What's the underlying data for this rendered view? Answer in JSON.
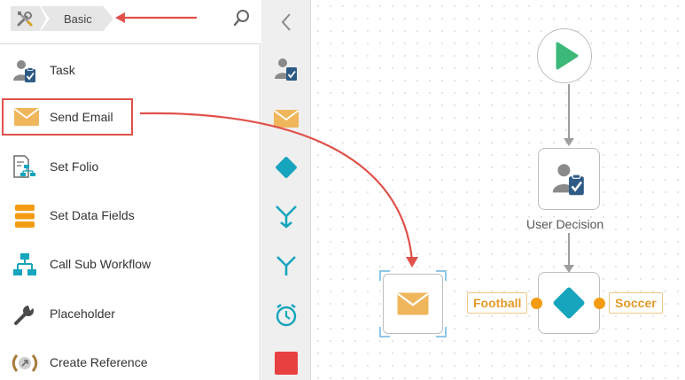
{
  "toolbox": {
    "breadcrumb": {
      "root_icon": "tools-icon",
      "current": "Basic"
    },
    "search_icon": "search-icon",
    "items": [
      {
        "label": "Task",
        "icon": "user-task-icon"
      },
      {
        "label": "Send Email",
        "icon": "envelope-icon"
      },
      {
        "label": "Set Folio",
        "icon": "folio-icon"
      },
      {
        "label": "Set Data Fields",
        "icon": "data-fields-icon"
      },
      {
        "label": "Call Sub Workflow",
        "icon": "sub-workflow-icon"
      },
      {
        "label": "Placeholder",
        "icon": "wrench-icon"
      },
      {
        "label": "Create Reference",
        "icon": "reference-icon"
      }
    ]
  },
  "strip": {
    "collapse_icon": "chevron-left-icon",
    "icons": [
      "user-task-icon",
      "envelope-icon",
      "decision-diamond-icon",
      "merge-icon",
      "split-icon",
      "timer-icon",
      "end-square-icon"
    ]
  },
  "canvas": {
    "user_decision_caption": "User Decision",
    "branch_left": "Football",
    "branch_right": "Soccer"
  },
  "colors": {
    "accent_red": "#e0514a",
    "envelope": "#f0b65c",
    "teal": "#16a5bd",
    "start_green": "#3cb878",
    "orange_port": "#f39c12",
    "stop_red": "#e84040"
  }
}
